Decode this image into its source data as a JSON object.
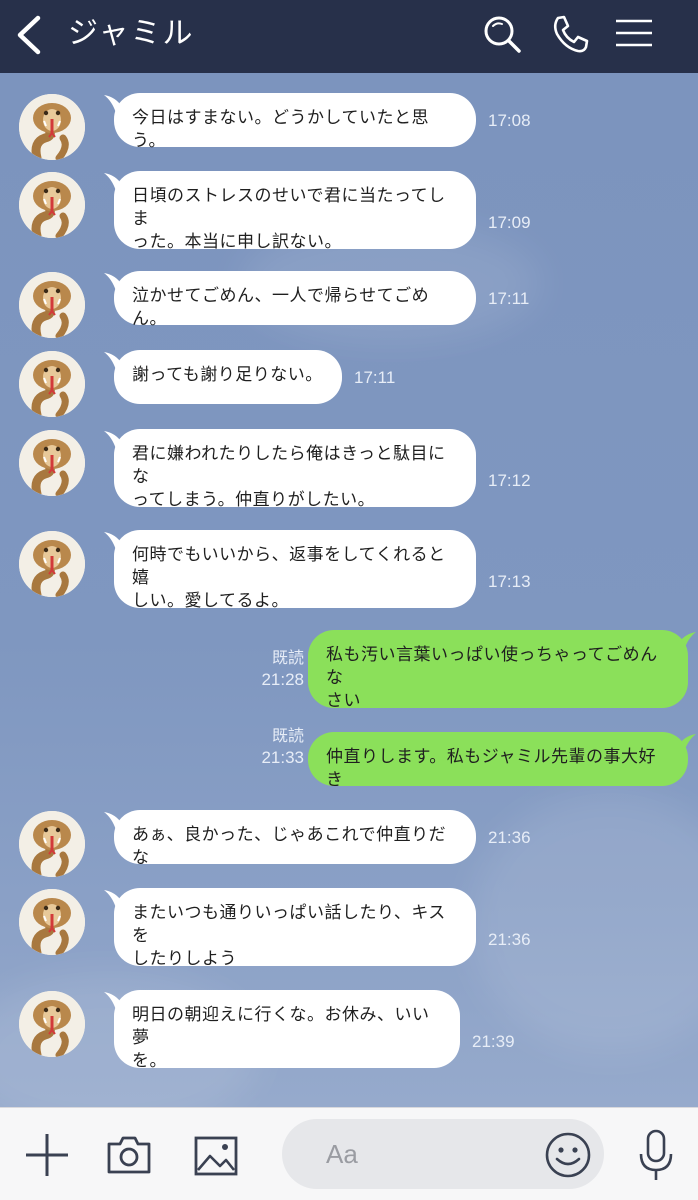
{
  "header": {
    "title": "ジャミル",
    "icons": [
      "back-icon",
      "search-icon",
      "phone-icon",
      "menu-icon"
    ]
  },
  "messages": [
    {
      "side": "left",
      "lines": [
        "今日はすまない。どうかしていたと思う。"
      ],
      "time": "17:08"
    },
    {
      "side": "left",
      "lines": [
        "日頃のストレスのせいで君に当たってしま",
        "った。本当に申し訳ない。"
      ],
      "time": "17:09"
    },
    {
      "side": "left",
      "lines": [
        "泣かせてごめん、一人で帰らせてごめん。"
      ],
      "time": "17:11"
    },
    {
      "side": "left",
      "lines": [
        "謝っても謝り足りない。"
      ],
      "time": "17:11"
    },
    {
      "side": "left",
      "lines": [
        "君に嫌われたりしたら俺はきっと駄目にな",
        "ってしまう。仲直りがしたい。"
      ],
      "time": "17:12"
    },
    {
      "side": "left",
      "lines": [
        "何時でもいいから、返事をしてくれると嬉",
        "しい。愛してるよ。"
      ],
      "time": "17:13"
    },
    {
      "side": "right",
      "lines": [
        "私も汚い言葉いっぱい使っちゃってごめんな",
        "さい"
      ],
      "read": "既読",
      "time": "21:28"
    },
    {
      "side": "right",
      "lines": [
        "仲直りします。私もジャミル先輩の事大好き"
      ],
      "read": "既読",
      "time": "21:33"
    },
    {
      "side": "left",
      "lines": [
        "あぁ、良かった、じゃあこれで仲直りだな"
      ],
      "time": "21:36"
    },
    {
      "side": "left",
      "lines": [
        "またいつも通りいっぱい話したり、キスを",
        "したりしよう"
      ],
      "time": "21:36"
    },
    {
      "side": "left",
      "lines": [
        "明日の朝迎えに行くな。お休み、いい夢",
        "を。"
      ],
      "time": "21:39"
    }
  ],
  "footer": {
    "input_placeholder": "Aa",
    "icons": [
      "plus-icon",
      "camera-icon",
      "image-icon",
      "emoji-icon",
      "mic-icon"
    ]
  },
  "colors": {
    "header_bg": "#27304a",
    "chat_bg": "#7b94bd",
    "sent_bubble": "#8be05a",
    "received_bubble": "#ffffff"
  }
}
